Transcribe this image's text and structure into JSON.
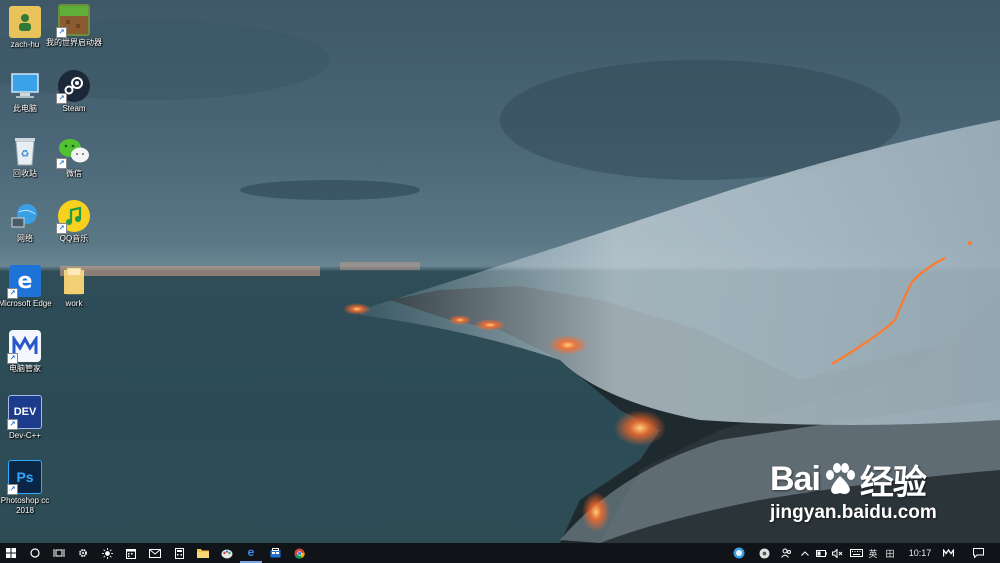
{
  "desktop": {
    "icons": [
      {
        "label": "zach-hu",
        "icon": "user-folder-icon"
      },
      {
        "label": "我的世界启动器",
        "icon": "minecraft-icon"
      },
      {
        "label": "此电脑",
        "icon": "computer-icon"
      },
      {
        "label": "Steam",
        "icon": "steam-icon"
      },
      {
        "label": "回收站",
        "icon": "recycle-bin-icon"
      },
      {
        "label": "微信",
        "icon": "wechat-icon"
      },
      {
        "label": "网络",
        "icon": "network-icon"
      },
      {
        "label": "QQ音乐",
        "icon": "qq-music-icon"
      },
      {
        "label": "Microsoft Edge",
        "icon": "edge-icon"
      },
      {
        "label": "work",
        "icon": "folder-icon"
      },
      {
        "label": "电脑管家",
        "icon": "pc-manager-icon"
      },
      {
        "label": "Dev-C++",
        "icon": "dev-cpp-icon"
      },
      {
        "label": "Photoshop cc 2018",
        "icon": "photoshop-icon"
      }
    ],
    "icon_glyphs": {
      "edge": "e",
      "dev": "DEV",
      "ps": "Ps",
      "shortcut": "↗"
    }
  },
  "watermark": {
    "logo_left": "Bai",
    "logo_right": "经验",
    "url": "jingyan.baidu.com"
  },
  "taskbar": {
    "pinned": [
      "start-icon",
      "search-circle-icon",
      "task-view-icon",
      "settings-gear-icon",
      "brightness-icon",
      "calendar-icon",
      "mail-icon",
      "calculator-icon",
      "file-explorer-icon",
      "paint-icon",
      "edge-icon",
      "store-icon",
      "chrome-icon"
    ],
    "tray": {
      "ime_lang": "英",
      "ime_mode": "田",
      "time": "10:17"
    }
  },
  "colors": {
    "taskbar_bg": "#101418",
    "lava": "#ff6a2a",
    "edge_blue": "#1e73d8",
    "dev_blue": "#1c3b8a",
    "ps_blue": "#0b2545",
    "steam": "#1b2838",
    "wechat": "#51c332",
    "qqmusic": "#f7d11e"
  }
}
